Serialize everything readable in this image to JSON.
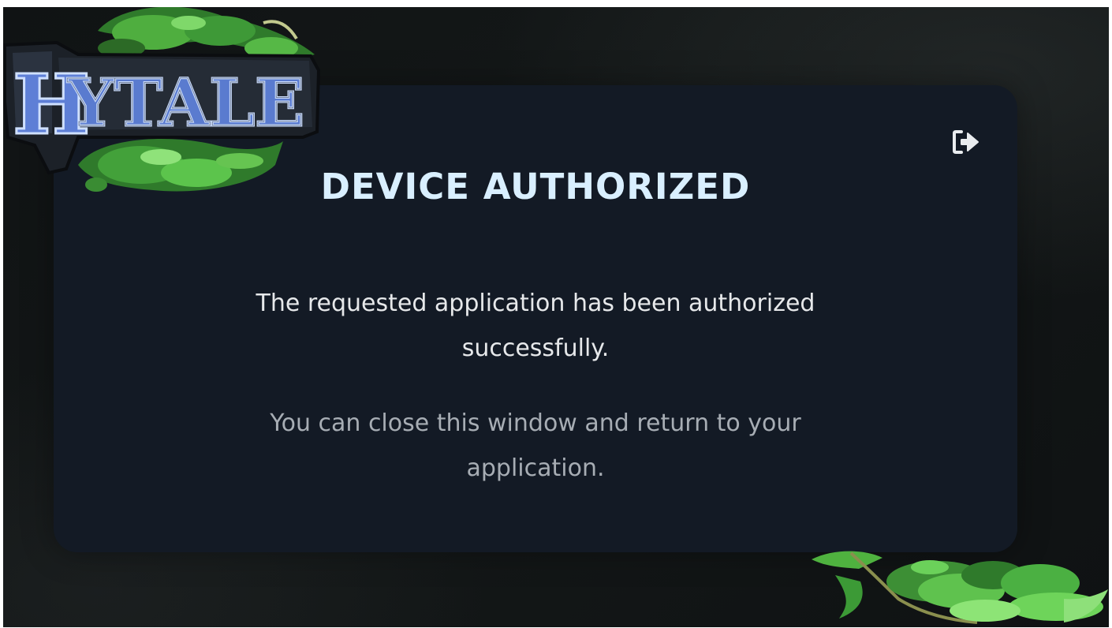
{
  "brand": {
    "logo_text": "HYTALE"
  },
  "card": {
    "title": "DEVICE AUTHORIZED",
    "message_primary": "The requested application has been authorized successfully.",
    "message_secondary": "You can close this window and return to your application."
  },
  "icons": {
    "logout": "logout-icon"
  },
  "colors": {
    "background": "#121617",
    "card": "#131a25",
    "title": "#d9efff",
    "text_primary": "#e6e8ea",
    "text_secondary": "#a7adb4",
    "leaf_green": "#5fd35a"
  }
}
